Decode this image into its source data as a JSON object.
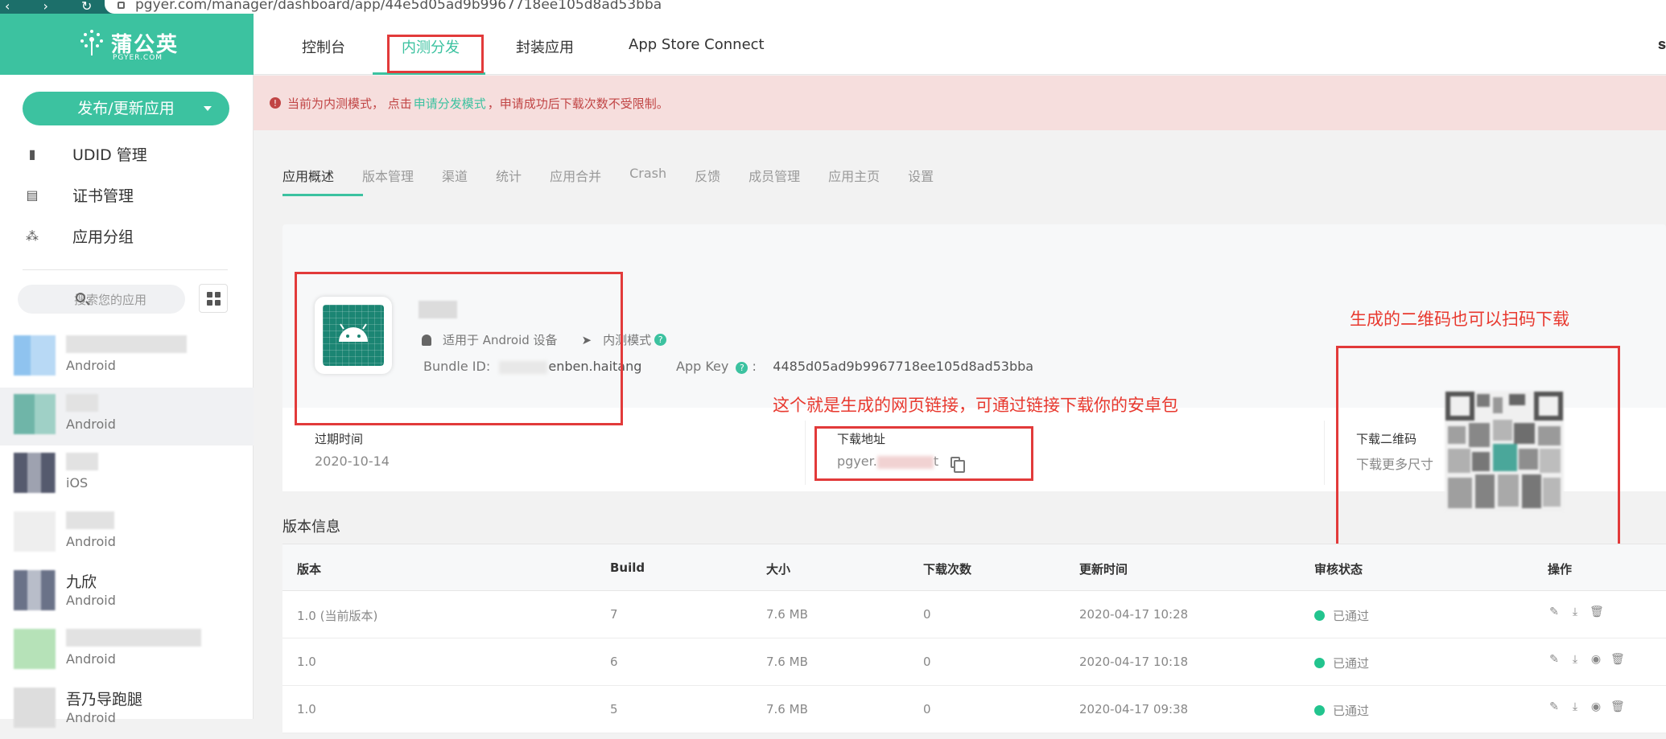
{
  "browser": {
    "url": "pgyer.com/manager/dashboard/app/44e5d05ad9b9967718ee105d8ad53bba",
    "nav_glyphs": "‹ › ↻"
  },
  "sidebar": {
    "logo_text": "蒲公英",
    "logo_sub": "PGYER.COM",
    "publish_button": "发布/更新应用",
    "menu": [
      {
        "label": "UDID 管理",
        "icon": "phone-icon"
      },
      {
        "label": "证书管理",
        "icon": "certificate-icon"
      },
      {
        "label": "应用分组",
        "icon": "sitemap-icon"
      }
    ],
    "search_placeholder": "搜索您的应用",
    "apps": [
      {
        "name": "",
        "platform": "Android",
        "color": "#8fc3ef"
      },
      {
        "name": "",
        "platform": "Android",
        "color": "#6fb5a8"
      },
      {
        "name": "",
        "platform": "iOS",
        "color": "#555a6e"
      },
      {
        "name": "",
        "platform": "Android",
        "color": "#eeeeee"
      },
      {
        "name": "九欣",
        "platform": "Android",
        "color": "#6a7288"
      },
      {
        "name": "",
        "platform": "Android",
        "color": "#b6e2b8"
      },
      {
        "name": "吾乃导跑腿",
        "platform": "Android",
        "color": "#dddddd"
      }
    ]
  },
  "topnav": {
    "tabs": [
      "控制台",
      "内测分发",
      "封装应用",
      "App Store Connect"
    ],
    "edge_text": "𝐬"
  },
  "alert": {
    "prefix": "当前为内测模式， 点击",
    "link": "申请分发模式",
    "suffix": "，申请成功后下载次数不受限制。"
  },
  "subtabs": [
    "应用概述",
    "版本管理",
    "渠道",
    "统计",
    "应用合并",
    "Crash",
    "反馈",
    "成员管理",
    "应用主页",
    "设置"
  ],
  "app": {
    "platform_label": "适用于 Android 设备",
    "mode_label": "内测模式",
    "bundle_label": "Bundle ID:",
    "bundle_value": "enben.haitang",
    "appkey_label": "App Key",
    "appkey_value": "4485d05ad9b9967718ee105d8ad53bba",
    "expire_label": "过期时间",
    "expire_value": "2020-10-14",
    "download_label": "下载地址",
    "download_prefix": "pgyer.",
    "download_suffix": "t",
    "qr_label": "下载二维码",
    "qr_more": "下载更多尺寸"
  },
  "annotations": {
    "link_note": "这个就是生成的网页链接，可通过链接下载你的安卓包",
    "qr_note": "生成的二维码也可以扫码下载"
  },
  "versions": {
    "title": "版本信息",
    "columns": [
      "版本",
      "Build",
      "大小",
      "下载次数",
      "更新时间",
      "审核状态",
      "操作"
    ],
    "rows": [
      {
        "version": "1.0 (当前版本)",
        "build": "7",
        "size": "7.6 MB",
        "downloads": "0",
        "updated": "2020-04-17 10:28",
        "status": "已通过"
      },
      {
        "version": "1.0",
        "build": "6",
        "size": "7.6 MB",
        "downloads": "0",
        "updated": "2020-04-17 10:18",
        "status": "已通过"
      },
      {
        "version": "1.0",
        "build": "5",
        "size": "7.6 MB",
        "downloads": "0",
        "updated": "2020-04-17 09:38",
        "status": "已通过"
      }
    ]
  },
  "colors": {
    "brand": "#3cc2a0",
    "alert_bg": "#f6dedd",
    "alert_text": "#c14545",
    "annotation": "#e8392f",
    "status_ok": "#22c48e"
  }
}
